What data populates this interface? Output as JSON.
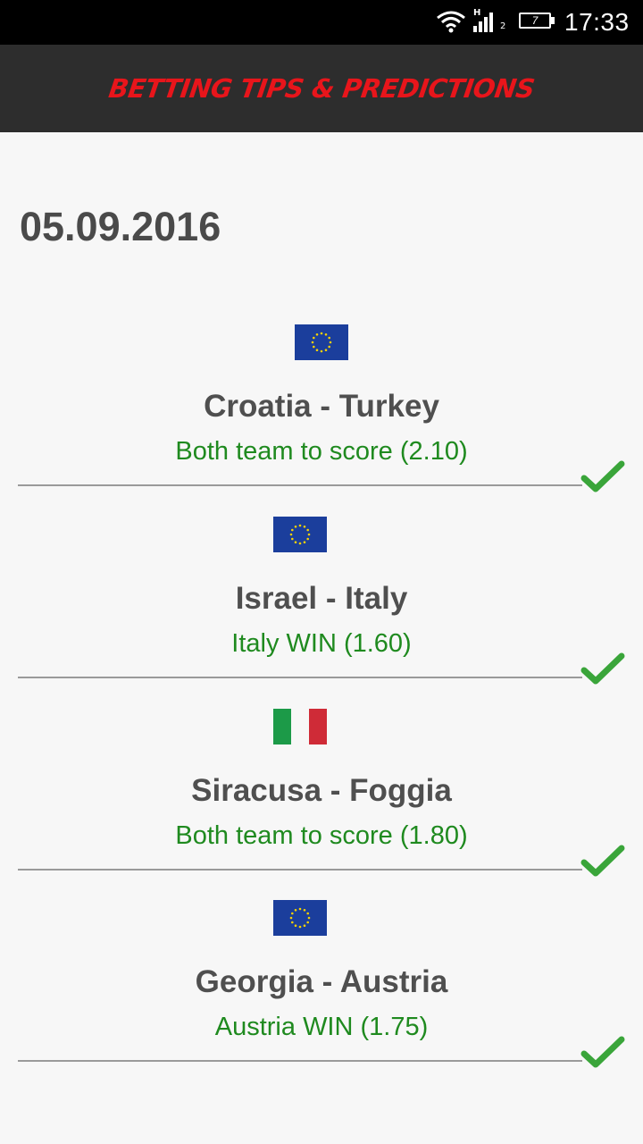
{
  "status_bar": {
    "battery_level": "7",
    "signal_h": "H",
    "signal_sim": "2",
    "time": "17:33"
  },
  "header": {
    "title": "BETTING TIPS & PREDICTIONS",
    "title_color": "#e8151b",
    "background": "#2d2d2d"
  },
  "date": "05.09.2016",
  "tips": [
    {
      "flag": "eu-flag-icon",
      "match": "Croatia - Turkey",
      "prediction": "Both team to score (2.10)",
      "result": "check-icon"
    },
    {
      "flag": "eu-flag-icon",
      "match": "Israel - Italy",
      "prediction": "Italy WIN (1.60)",
      "result": "check-icon"
    },
    {
      "flag": "italy-flag-icon",
      "match": "Siracusa - Foggia",
      "prediction": "Both team to score (1.80)",
      "result": "check-icon"
    },
    {
      "flag": "eu-flag-icon",
      "match": "Georgia - Austria",
      "prediction": "Austria WIN (1.75)",
      "result": "check-icon"
    }
  ],
  "colors": {
    "prediction": "#1f8a1f",
    "check": "#3aa53a",
    "match_title": "#4f4f4f"
  }
}
